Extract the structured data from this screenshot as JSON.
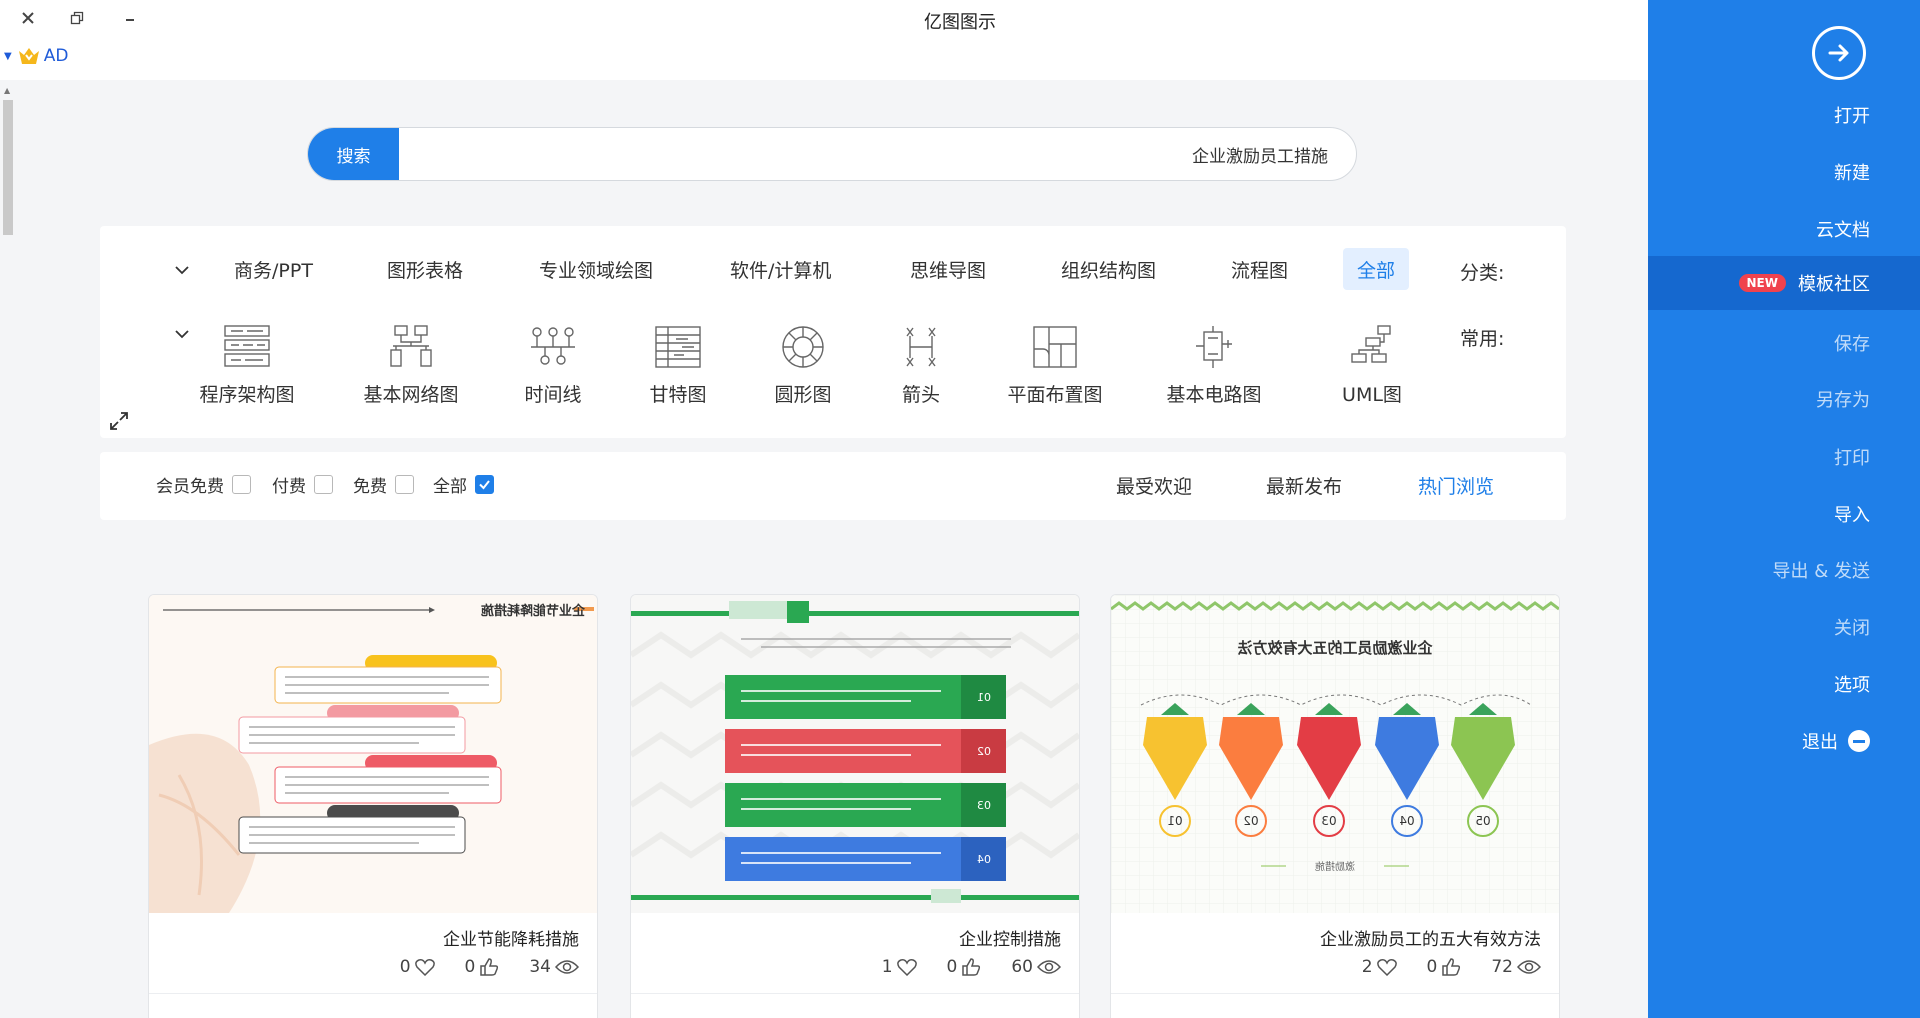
{
  "window": {
    "title": "亿图图示",
    "account": "AD"
  },
  "sidebar": {
    "items": [
      {
        "label": "打开",
        "dim": false
      },
      {
        "label": "新建",
        "dim": false
      },
      {
        "label": "云文档",
        "dim": false
      },
      {
        "label": "模板社区",
        "dim": false,
        "badge": "NEW",
        "active": true
      },
      {
        "label": "保存",
        "dim": true
      },
      {
        "label": "另存为",
        "dim": true
      },
      {
        "label": "打印",
        "dim": true
      },
      {
        "label": "导入",
        "dim": false
      },
      {
        "label": "导出 & 发送",
        "dim": true
      },
      {
        "label": "关闭",
        "dim": true
      },
      {
        "label": "选项",
        "dim": false
      },
      {
        "label": "退出",
        "dim": false
      }
    ]
  },
  "search": {
    "button": "搜索",
    "value": "企业激励员工措施"
  },
  "categories": {
    "label": "分类:",
    "tabs": [
      "全部",
      "流程图",
      "组织结构图",
      "思维导图",
      "软件/计算机",
      "专业领域绘图",
      "图形表格",
      "商务/PPT"
    ],
    "selected": "全部"
  },
  "common": {
    "label": "常用:",
    "items": [
      {
        "label": "UML图",
        "icon": "uml-icon"
      },
      {
        "label": "基本电路图",
        "icon": "circuit-icon"
      },
      {
        "label": "平面布置图",
        "icon": "floorplan-icon"
      },
      {
        "label": "箭头",
        "icon": "arrow-shape-icon"
      },
      {
        "label": "圆形图",
        "icon": "circle-diagram-icon"
      },
      {
        "label": "甘特图",
        "icon": "gantt-icon"
      },
      {
        "label": "时间线",
        "icon": "timeline-icon"
      },
      {
        "label": "基本网络图",
        "icon": "network-icon"
      },
      {
        "label": "程序架构图",
        "icon": "architecture-icon"
      }
    ]
  },
  "sort": {
    "tabs": [
      "热门浏览",
      "最新发布",
      "最受欢迎"
    ],
    "selected": "热门浏览"
  },
  "filters": [
    {
      "label": "全部",
      "checked": true
    },
    {
      "label": "免费",
      "checked": false
    },
    {
      "label": "付费",
      "checked": false
    },
    {
      "label": "会员免费",
      "checked": false
    }
  ],
  "cards": [
    {
      "title": "企业激励员工的五大有效方法",
      "views": "72",
      "likes": "0",
      "favorites": "2",
      "thumb_title": "企业激励员工的五大有效方法",
      "nums": [
        "01",
        "02",
        "03",
        "04",
        "05"
      ],
      "footer_text": "激励措施"
    },
    {
      "title": "企业控制措施",
      "views": "60",
      "likes": "0",
      "favorites": "1",
      "nums": [
        "01",
        "02",
        "03",
        "04"
      ]
    },
    {
      "title": "企业节能降耗措施",
      "views": "34",
      "likes": "0",
      "favorites": "0",
      "thumb_title": "企业节能降耗措施"
    }
  ],
  "colors": {
    "accent": "#1f7fe8",
    "sidebar": "#1f7fe8",
    "new_badge": "#f0424d"
  }
}
